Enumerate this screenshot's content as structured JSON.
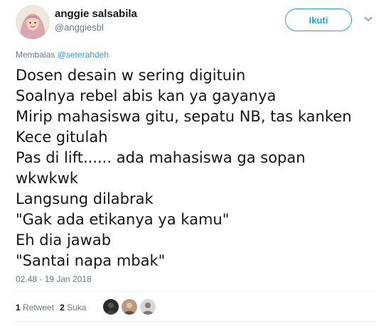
{
  "author": {
    "display_name": "anggie salsabila",
    "handle": "@anggiesbl",
    "avatar_icon": "user-avatar-hijab"
  },
  "follow_button": {
    "label": "Ikuti"
  },
  "menu": {
    "icon": "chevron-down-icon"
  },
  "reply_context": {
    "prefix": "Membalas",
    "mention": "@seterahdeh"
  },
  "tweet": {
    "lines": [
      "Dosen desain w sering digituin",
      "Soalnya rebel abis kan ya gayanya",
      "Mirip mahasiswa gitu, sepatu NB, tas kanken",
      "Kece gitulah",
      "Pas di lift...... ada mahasiswa ga sopan",
      "wkwkwk",
      "Langsung dilabrak",
      "\"Gak ada etikanya ya kamu\"",
      "Eh dia jawab",
      "\"Santai napa mbak\""
    ],
    "timestamp": "02.48 - 19 Jan 2018"
  },
  "stats": {
    "retweets_count": "1",
    "retweets_label": "Retweet",
    "likes_count": "2",
    "likes_label": "Suka"
  },
  "colors": {
    "accent": "#1da1f2",
    "muted": "#657786",
    "divider": "#e6ecf0"
  }
}
